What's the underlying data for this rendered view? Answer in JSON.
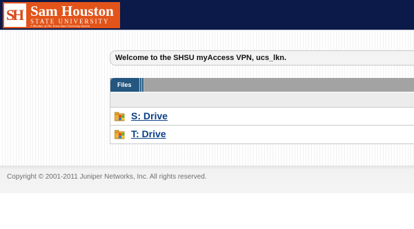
{
  "header": {
    "logo": {
      "mark": "SH",
      "name": "Sam Houston",
      "subtitle": "STATE UNIVERSITY",
      "member_line": "A Member of The Texas State University System"
    },
    "colors": {
      "bar": "#0b1a48",
      "logo": "#e2541a"
    }
  },
  "welcome": {
    "text": "Welcome to the SHSU myAccess VPN, ucs_lkn."
  },
  "files_panel": {
    "tab_label": "Files",
    "items": [
      {
        "label": "S: Drive",
        "icon": "windows-network-drive-icon"
      },
      {
        "label": "T: Drive",
        "icon": "windows-network-drive-icon"
      }
    ]
  },
  "footer": {
    "copyright": "Copyright © 2001-2011 Juniper Networks, Inc. All rights reserved."
  }
}
